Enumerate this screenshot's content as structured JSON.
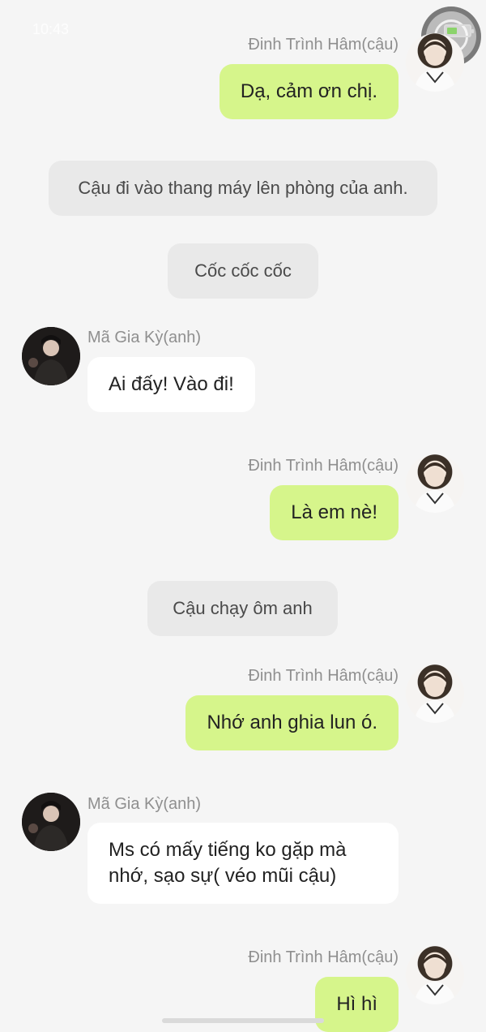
{
  "status_bar": {
    "time": "10:43"
  },
  "messages": [
    {
      "type": "sent",
      "name": "Đinh Trình Hâm(cậu)",
      "text": "Dạ, cảm ơn chị."
    },
    {
      "type": "narration",
      "text": "Cậu đi vào thang máy lên phòng của anh."
    },
    {
      "type": "narration",
      "text": "Cốc cốc cốc"
    },
    {
      "type": "received",
      "name": "Mã Gia Kỳ(anh)",
      "text": "Ai đấy! Vào đi!"
    },
    {
      "type": "sent",
      "name": "Đinh Trình Hâm(cậu)",
      "text": "Là em nè!"
    },
    {
      "type": "narration",
      "text": "Cậu chạy ôm anh"
    },
    {
      "type": "sent",
      "name": "Đinh Trình Hâm(cậu)",
      "text": "Nhớ anh ghia lun ó."
    },
    {
      "type": "received",
      "name": "Mã Gia Kỳ(anh)",
      "text": "Ms có mấy tiếng ko gặp mà nhớ, sạo sự( véo mũi cậu)"
    },
    {
      "type": "sent",
      "name": "Đinh Trình Hâm(cậu)",
      "text": "Hì hì"
    }
  ],
  "colors": {
    "background": "#f5f5f5",
    "sent_bubble": "#d6f58b",
    "received_bubble": "#ffffff",
    "narration_bubble": "#e9e9e9",
    "name_text": "#8f8f8f"
  },
  "icons": {
    "avatar_sent": "user-avatar-light",
    "avatar_received": "user-avatar-dark",
    "battery": "battery-icon",
    "floating_ball": "assistive-touch-icon"
  }
}
